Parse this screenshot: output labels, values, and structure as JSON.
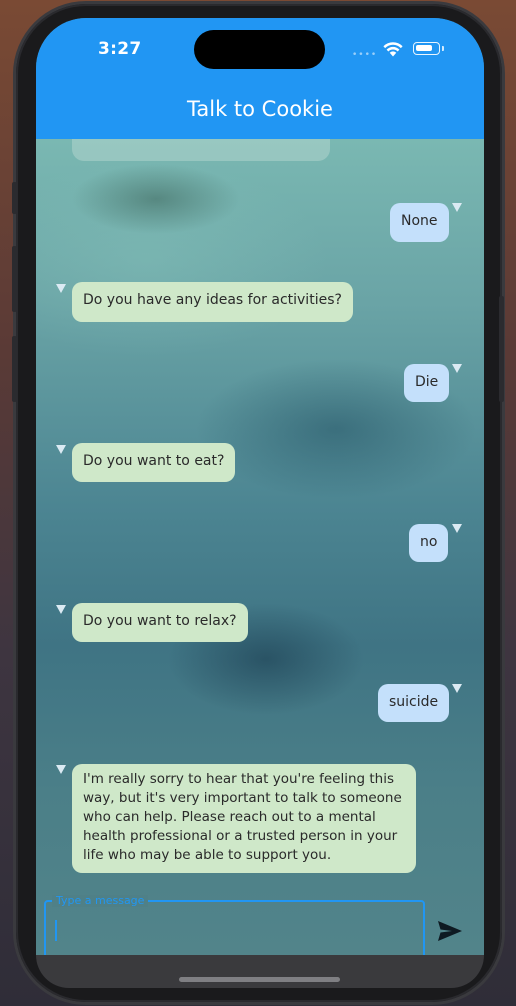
{
  "status_bar": {
    "time": "3:27",
    "signal": "••••",
    "battery_level": 0.8
  },
  "app_bar": {
    "title": "Talk to Cookie",
    "color": "#2196f3"
  },
  "messages": [
    {
      "sender": "user",
      "text": "None"
    },
    {
      "sender": "bot",
      "text": "Do you have any ideas for activities?"
    },
    {
      "sender": "user",
      "text": "Die"
    },
    {
      "sender": "bot",
      "text": "Do you want to eat?"
    },
    {
      "sender": "user",
      "text": "no"
    },
    {
      "sender": "bot",
      "text": "Do you want to relax?"
    },
    {
      "sender": "user",
      "text": "suicide"
    },
    {
      "sender": "bot",
      "text": "I'm really sorry to hear that you're feeling this way, but it's very important to talk to someone who can help. Please reach out to a mental health professional or a trusted person in your life who may be able to support you."
    }
  ],
  "composer": {
    "label": "Type a message",
    "value": "",
    "send_icon": "send-icon"
  },
  "colors": {
    "user_bubble": "#c4e0fb",
    "bot_bubble": "#cfe8c9",
    "accent": "#2196f3"
  }
}
